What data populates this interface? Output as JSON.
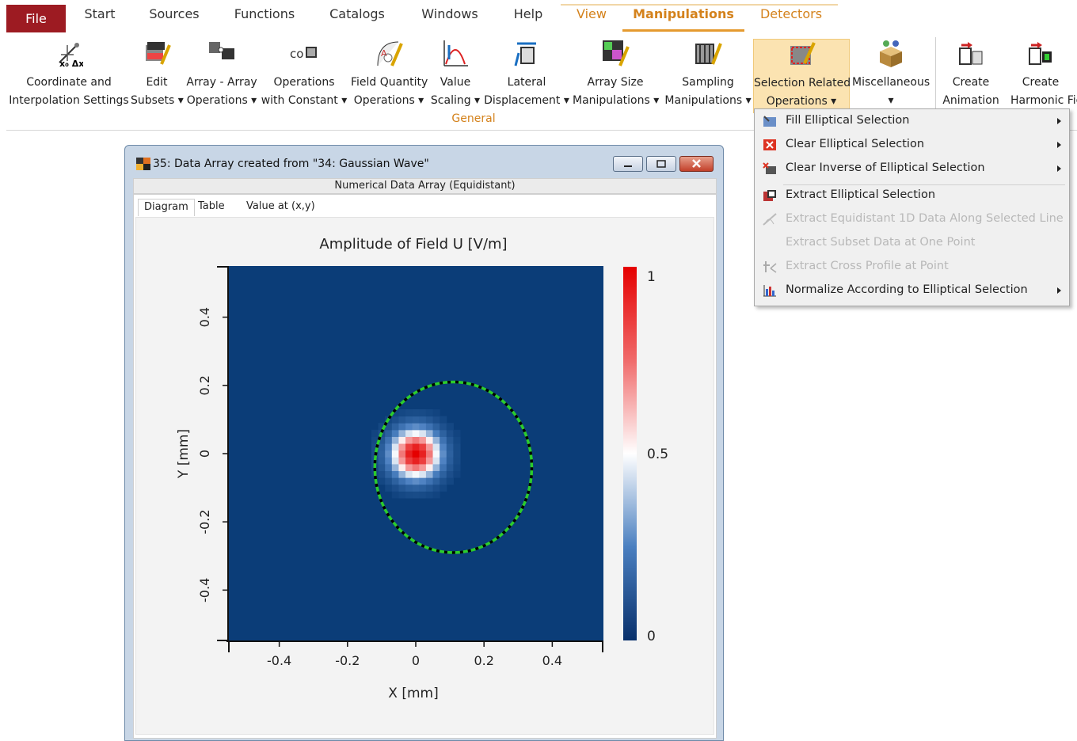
{
  "ribbon": {
    "tabs": [
      "File",
      "Start",
      "Sources",
      "Functions",
      "Catalogs",
      "Windows",
      "Help",
      "View",
      "Manipulations",
      "Detectors"
    ],
    "active_tab": "Manipulations",
    "buttons": [
      {
        "line1": "Coordinate and",
        "line2": "Interpolation Settings",
        "icon": "coordinate-axes-icon"
      },
      {
        "line1": "Edit",
        "line2": "Subsets ▾",
        "icon": "edit-subsets-icon"
      },
      {
        "line1": "Array - Array",
        "line2": "Operations ▾",
        "icon": "array-operations-icon"
      },
      {
        "line1": "Operations",
        "line2": "with Constant ▾",
        "icon": "constant-operation-icon"
      },
      {
        "line1": "Field Quantity",
        "line2": "Operations ▾",
        "icon": "field-quantity-icon"
      },
      {
        "line1": "Value",
        "line2": "Scaling ▾",
        "icon": "value-scaling-icon"
      },
      {
        "line1": "Lateral",
        "line2": "Displacement ▾",
        "icon": "lateral-displacement-icon"
      },
      {
        "line1": "Array Size",
        "line2": "Manipulations ▾",
        "icon": "array-size-icon"
      },
      {
        "line1": "Sampling",
        "line2": "Manipulations ▾",
        "icon": "sampling-icon"
      },
      {
        "line1": "Selection Related",
        "line2": "Operations ▾",
        "icon": "selection-icon"
      },
      {
        "line1": "Miscellaneous",
        "line2": "▾",
        "icon": "miscellaneous-icon"
      },
      {
        "line1": "Create",
        "line2": "Animation",
        "icon": "animation-icon"
      },
      {
        "line1": "Create",
        "line2": "Harmonic Fie",
        "icon": "harmonic-field-icon"
      }
    ],
    "group_label": "General",
    "accent_color": "#d4821c",
    "file_tab_color": "#9d1b22"
  },
  "menu": {
    "items": [
      {
        "label": "Fill Elliptical Selection",
        "enabled": true,
        "submenu": true
      },
      {
        "label": "Clear Elliptical Selection",
        "enabled": true,
        "submenu": true
      },
      {
        "label": "Clear Inverse of Elliptical Selection",
        "enabled": true,
        "submenu": true
      },
      {
        "label": "Extract Elliptical Selection",
        "enabled": true,
        "submenu": false
      },
      {
        "label": "Extract Equidistant 1D Data Along Selected Line",
        "enabled": false,
        "submenu": false
      },
      {
        "label": "Extract Subset Data at One Point",
        "enabled": false,
        "submenu": false
      },
      {
        "label": "Extract Cross Profile at Point",
        "enabled": false,
        "submenu": false
      },
      {
        "label": "Normalize According to Elliptical Selection",
        "enabled": true,
        "submenu": true
      }
    ]
  },
  "window": {
    "title": "35: Data Array created from \"34: Gaussian Wave\"",
    "subtitle": "Numerical Data Array (Equidistant)",
    "view_tabs": [
      "Diagram",
      "Table",
      "Value at (x,y)"
    ],
    "active_view_tab": "Diagram"
  },
  "chart_data": {
    "type": "heatmap",
    "title": "Amplitude of Field U  [V/m]",
    "xlabel": "X [mm]",
    "ylabel": "Y [mm]",
    "xlim": [
      -0.55,
      0.55
    ],
    "ylim": [
      -0.55,
      0.55
    ],
    "xticks": [
      -0.4,
      -0.2,
      0,
      0.2,
      0.4
    ],
    "yticks": [
      -0.4,
      -0.2,
      0,
      0.2,
      0.4
    ],
    "xtick_labels": [
      "-0.4",
      "-0.2",
      "0",
      "0.2",
      "0.4"
    ],
    "ytick_labels": [
      "-0.4",
      "-0.2",
      "0",
      "0.2",
      "0.4"
    ],
    "colorbar": {
      "min": 0,
      "max": 1,
      "ticks": [
        0,
        0.5,
        1
      ],
      "tick_labels": [
        "0",
        "0.5",
        "1"
      ],
      "colors": [
        "#08306b",
        "#ffffff",
        "#e50000"
      ]
    },
    "gaussian": {
      "center_x": 0,
      "center_y": 0,
      "waist": 0.05,
      "peak": 1
    },
    "selection_ellipse": {
      "center_x": 0.11,
      "center_y": -0.04,
      "radius_x": 0.23,
      "radius_y": 0.25,
      "colors": [
        "#2ccc2c",
        "#000000"
      ]
    }
  }
}
